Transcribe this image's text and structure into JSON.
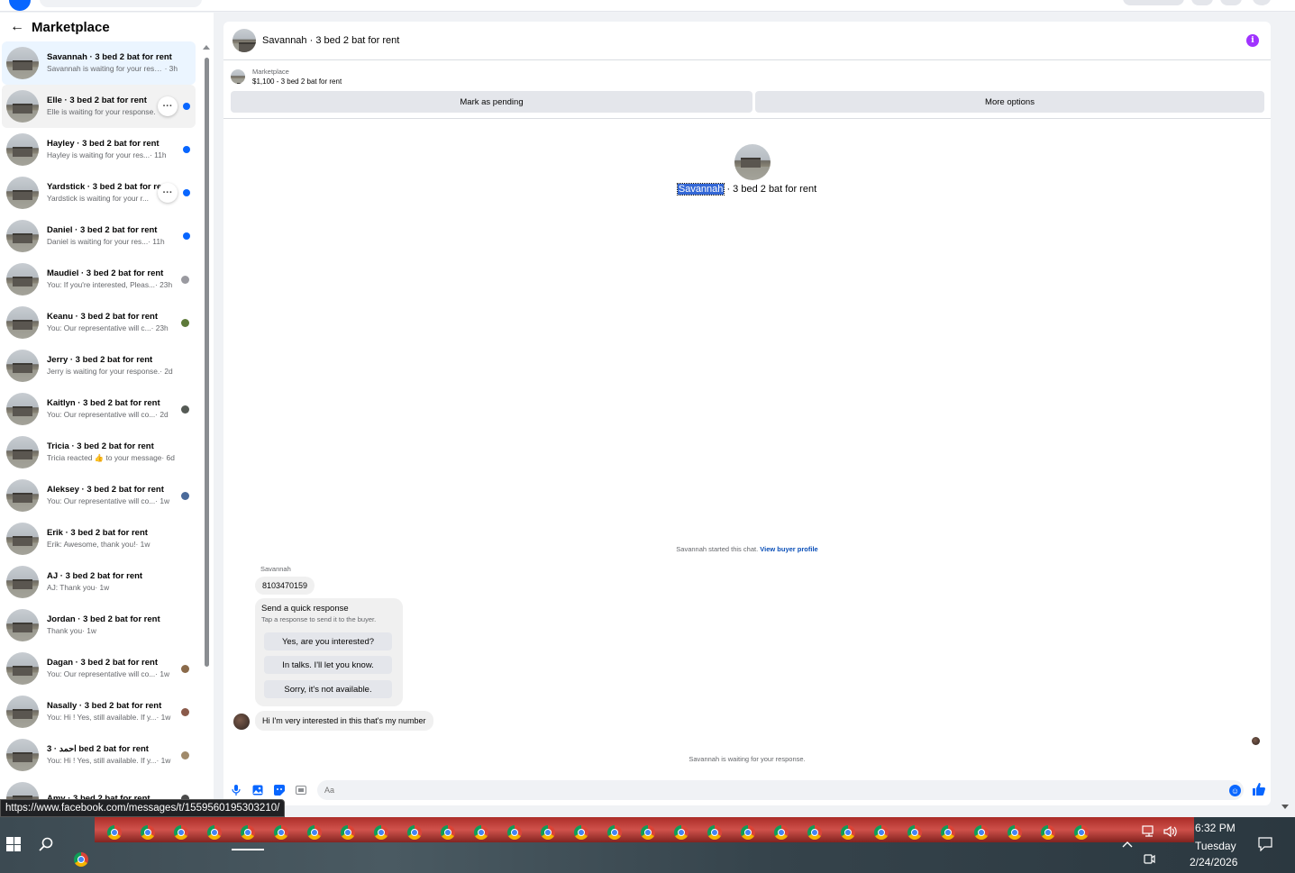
{
  "sidebar": {
    "title": "Marketplace",
    "conversations": [
      {
        "name": "Savannah · 3 bed 2 bat for rent",
        "preview": "Savannah is waiting for your resp...",
        "time": " · 3h",
        "state": "active",
        "indicator": "none"
      },
      {
        "name": "Elle · 3 bed 2 bat for rent",
        "preview": "Elle is waiting for your response.",
        "time": "",
        "state": "hover",
        "indicator": "unread",
        "more": true
      },
      {
        "name": "Hayley · 3 bed 2 bat for rent",
        "preview": "Hayley is waiting for your res...",
        "time": " · 11h",
        "state": "",
        "indicator": "unread"
      },
      {
        "name": "Yardstick · 3 bed 2 bat for rent",
        "preview": "Yardstick is waiting for your r...",
        "time": "",
        "state": "",
        "indicator": "unread",
        "more": true
      },
      {
        "name": "Daniel · 3 bed 2 bat for rent",
        "preview": "Daniel is waiting for your res...",
        "time": " · 11h",
        "state": "",
        "indicator": "unread"
      },
      {
        "name": "Maudiel · 3 bed 2 bat for rent",
        "preview": "You: If you're interested, Pleas...",
        "time": " · 23h",
        "state": "",
        "indicator": "seen",
        "seen_color": "#9a9aa0"
      },
      {
        "name": "Keanu · 3 bed 2 bat for rent",
        "preview": "You: Our representative will c...",
        "time": " · 23h",
        "state": "",
        "indicator": "seen",
        "seen_color": "#5e7a3a"
      },
      {
        "name": "Jerry · 3 bed 2 bat for rent",
        "preview": "Jerry is waiting for your response.",
        "time": " · 2d",
        "state": "",
        "indicator": "none"
      },
      {
        "name": "Kaitlyn · 3 bed 2 bat for rent",
        "preview": "You: Our representative will co...",
        "time": " · 2d",
        "state": "",
        "indicator": "seen",
        "seen_color": "#555a55"
      },
      {
        "name": "Tricia · 3 bed 2 bat for rent",
        "preview": "Tricia reacted 👍 to your message",
        "time": " · 6d",
        "state": "",
        "indicator": "none"
      },
      {
        "name": "Aleksey · 3 bed 2 bat for rent",
        "preview": "You: Our representative will co...",
        "time": " · 1w",
        "state": "",
        "indicator": "seen",
        "seen_color": "#4a6a9a"
      },
      {
        "name": "Erik · 3 bed 2 bat for rent",
        "preview": "Erik: Awesome, thank you!",
        "time": " · 1w",
        "state": "",
        "indicator": "none"
      },
      {
        "name": "AJ · 3 bed 2 bat for rent",
        "preview": "AJ: Thank you",
        "time": " · 1w",
        "state": "",
        "indicator": "none"
      },
      {
        "name": "Jordan · 3 bed 2 bat for rent",
        "preview": "Thank you",
        "time": " · 1w",
        "state": "",
        "indicator": "none"
      },
      {
        "name": "Dagan · 3 bed 2 bat for rent",
        "preview": "You: Our representative will co...",
        "time": " · 1w",
        "state": "",
        "indicator": "seen",
        "seen_color": "#8a6a4a"
      },
      {
        "name": "Nasally · 3 bed 2 bat for rent",
        "preview": "You: Hi ! Yes, still available. If y...",
        "time": " · 1w",
        "state": "",
        "indicator": "seen",
        "seen_color": "#8a5a4a"
      },
      {
        "name": "احمد · 3 bed 2 bat for rent",
        "preview": "You: Hi ! Yes, still available. If y...",
        "time": " · 1w",
        "state": "",
        "indicator": "seen",
        "seen_color": "#a08a6a"
      },
      {
        "name": "Amy · 3 bed 2 bat for rent",
        "preview": "",
        "time": "",
        "state": "",
        "indicator": "seen",
        "seen_color": "#4a4a4a"
      }
    ]
  },
  "chat": {
    "title": "Savannah · 3 bed 2 bat for rent",
    "listing_label": "Marketplace",
    "listing_title": "$1,100 - 3 bed 2 bat for rent",
    "mark_pending": "Mark as pending",
    "more_options": "More options",
    "profile_name_highlight": "Savannah",
    "profile_name_rest": " · 3 bed 2 bat for rent",
    "started_text": "Savannah started this chat.",
    "view_buyer_profile": "View buyer profile",
    "sender_label": "Savannah",
    "message_1": "8103470159",
    "quick_response_title": "Send a quick response",
    "quick_response_sub": "Tap a response to send it to the buyer.",
    "quick_options": [
      "Yes, are you interested?",
      "In talks. I'll let you know.",
      "Sorry, it's not available."
    ],
    "message_2": "Hi I'm very interested in this that's my number",
    "waiting_text": "Savannah is waiting for your response.",
    "composer_placeholder": "Aa"
  },
  "status_url": "https://www.facebook.com/messages/t/1559560195303210/",
  "clock": {
    "time": "6:32 PM",
    "day": "Tuesday",
    "date": "2/24/2026"
  },
  "colors": {
    "accent": "#0866ff",
    "info": "#a033ff",
    "highlight": "#3367d6"
  }
}
